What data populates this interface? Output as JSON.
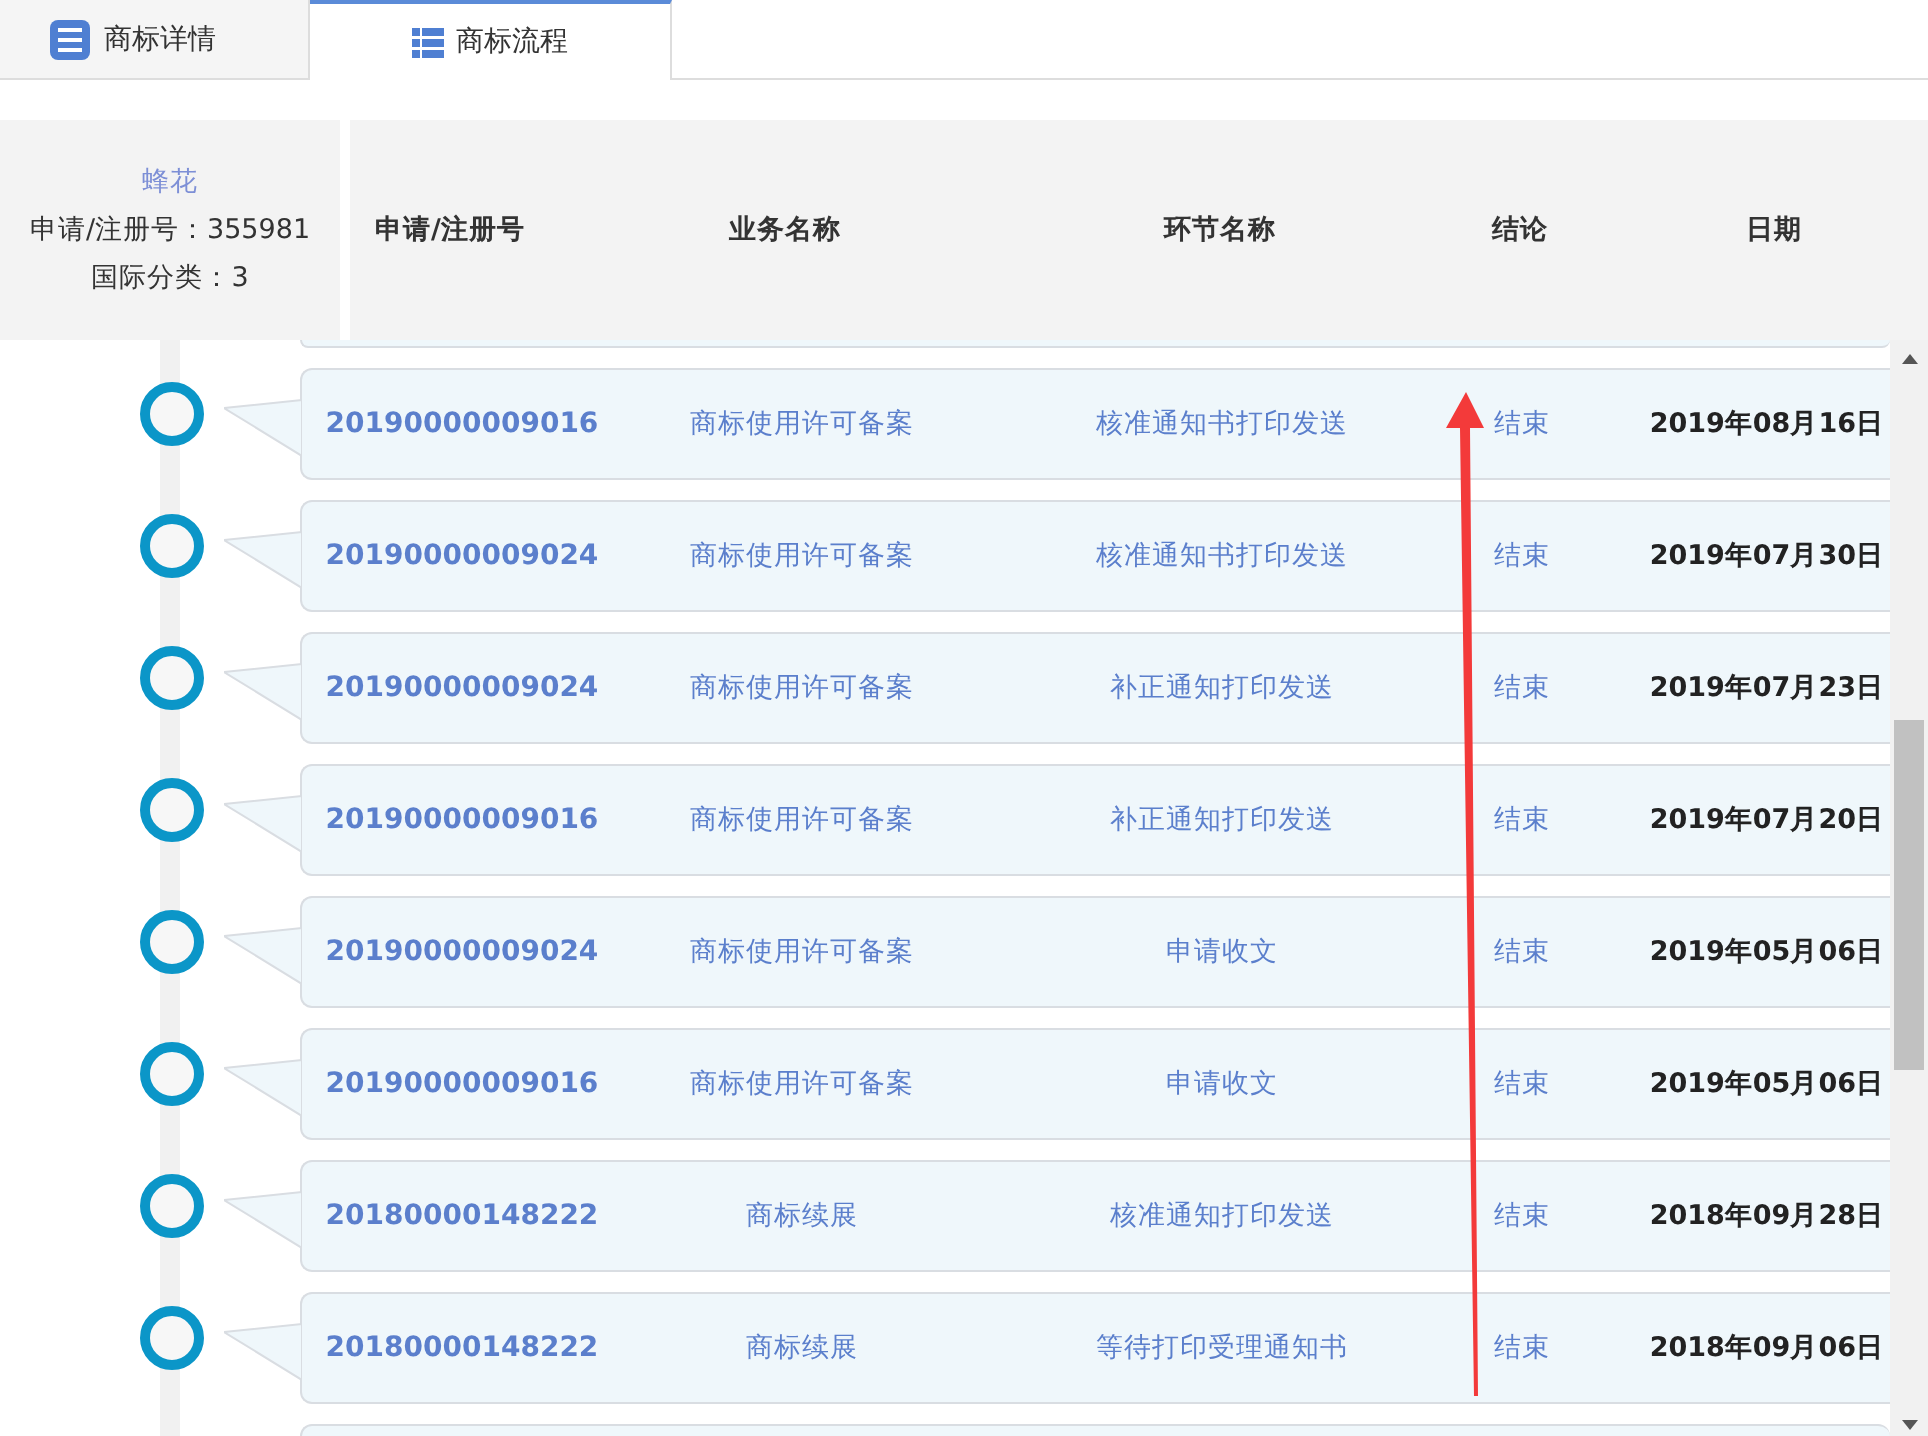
{
  "tabs": [
    {
      "label": "商标详情",
      "selected": false
    },
    {
      "label": "商标流程",
      "selected": true
    }
  ],
  "trademark": {
    "name": "蜂花",
    "registration": "申请/注册号：355981",
    "class": "国际分类：3"
  },
  "columns": [
    "申请/注册号",
    "业务名称",
    "环节名称",
    "结论",
    "日期"
  ],
  "rows": [
    {
      "reg_no": "20190000009016",
      "business": "商标使用许可备案",
      "step": "核准通知书打印发送",
      "result": "结束",
      "date": "2019年08月16日"
    },
    {
      "reg_no": "20190000009024",
      "business": "商标使用许可备案",
      "step": "核准通知书打印发送",
      "result": "结束",
      "date": "2019年07月30日"
    },
    {
      "reg_no": "20190000009024",
      "business": "商标使用许可备案",
      "step": "补正通知打印发送",
      "result": "结束",
      "date": "2019年07月23日"
    },
    {
      "reg_no": "20190000009016",
      "business": "商标使用许可备案",
      "step": "补正通知打印发送",
      "result": "结束",
      "date": "2019年07月20日"
    },
    {
      "reg_no": "20190000009024",
      "business": "商标使用许可备案",
      "step": "申请收文",
      "result": "结束",
      "date": "2019年05月06日"
    },
    {
      "reg_no": "20190000009016",
      "business": "商标使用许可备案",
      "step": "申请收文",
      "result": "结束",
      "date": "2019年05月06日"
    },
    {
      "reg_no": "20180000148222",
      "business": "商标续展",
      "step": "核准通知打印发送",
      "result": "结束",
      "date": "2018年09月28日"
    },
    {
      "reg_no": "20180000148222",
      "business": "商标续展",
      "step": "等待打印受理通知书",
      "result": "结束",
      "date": "2018年09月06日"
    }
  ]
}
